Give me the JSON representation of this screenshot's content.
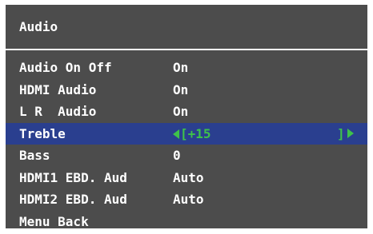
{
  "title": "Audio",
  "items": [
    {
      "label": "Audio On Off",
      "value": "On"
    },
    {
      "label": "HDMI Audio",
      "value": "On"
    },
    {
      "label": "L R  Audio",
      "value": "On"
    },
    {
      "label": "Treble",
      "value": "[+15",
      "right_bracket": "]",
      "selected": true
    },
    {
      "label": "Bass",
      "value": "0"
    },
    {
      "label": "HDMI1 EBD. Aud",
      "value": "Auto"
    },
    {
      "label": "HDMI2 EBD. Aud",
      "value": "Auto"
    },
    {
      "label": "Menu Back",
      "value": ""
    }
  ],
  "colors": {
    "panel": "#4c4c4c",
    "highlight": "#2a3f8f",
    "accent": "#3ec24a",
    "text": "#ffffff"
  }
}
